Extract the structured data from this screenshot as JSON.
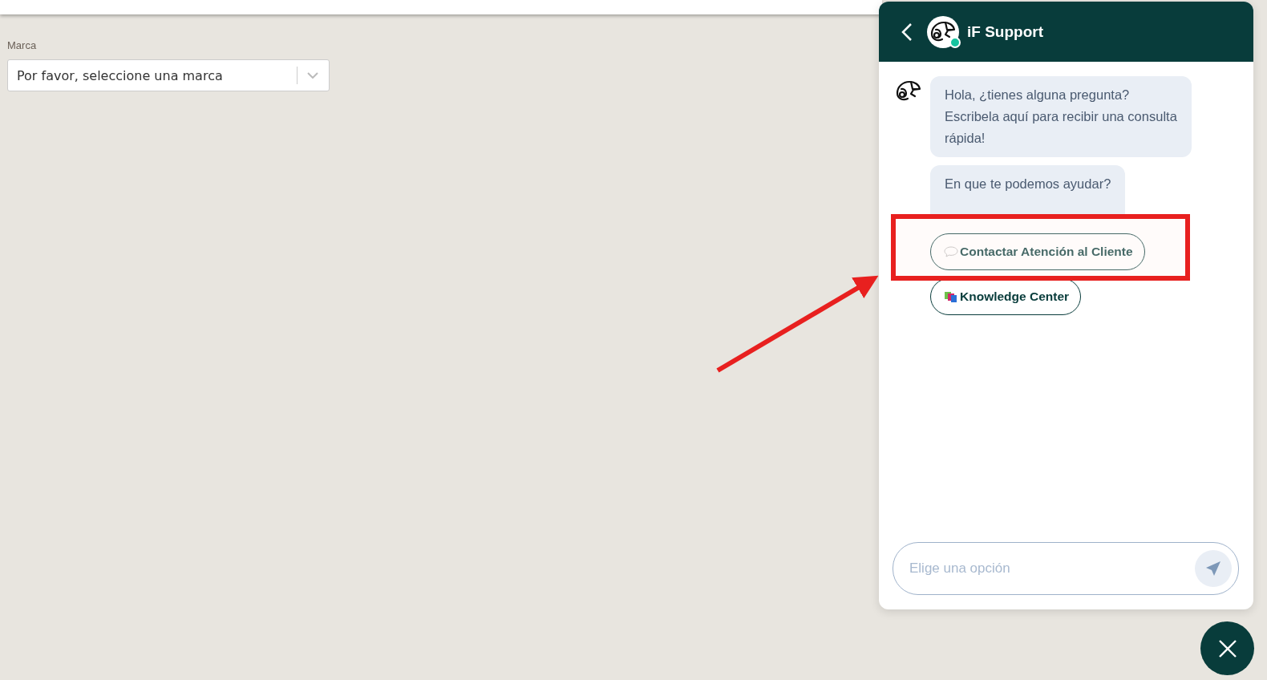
{
  "brand_field": {
    "label": "Marca",
    "placeholder": "Por favor, seleccione una marca"
  },
  "chat": {
    "title": "iF Support",
    "online": true,
    "messages": [
      {
        "lines": [
          "Hola, ¿tienes alguna pregunta?",
          "Escribela aquí para recibir una consulta rápida!"
        ]
      },
      {
        "lines": [
          "En que te podemos ayudar?"
        ]
      }
    ],
    "options": [
      {
        "kind": "chat",
        "label": "Contactar Atención al Cliente"
      },
      {
        "kind": "books",
        "label": "Knowledge Center"
      }
    ],
    "input": {
      "placeholder": "Elige una opción"
    }
  }
}
